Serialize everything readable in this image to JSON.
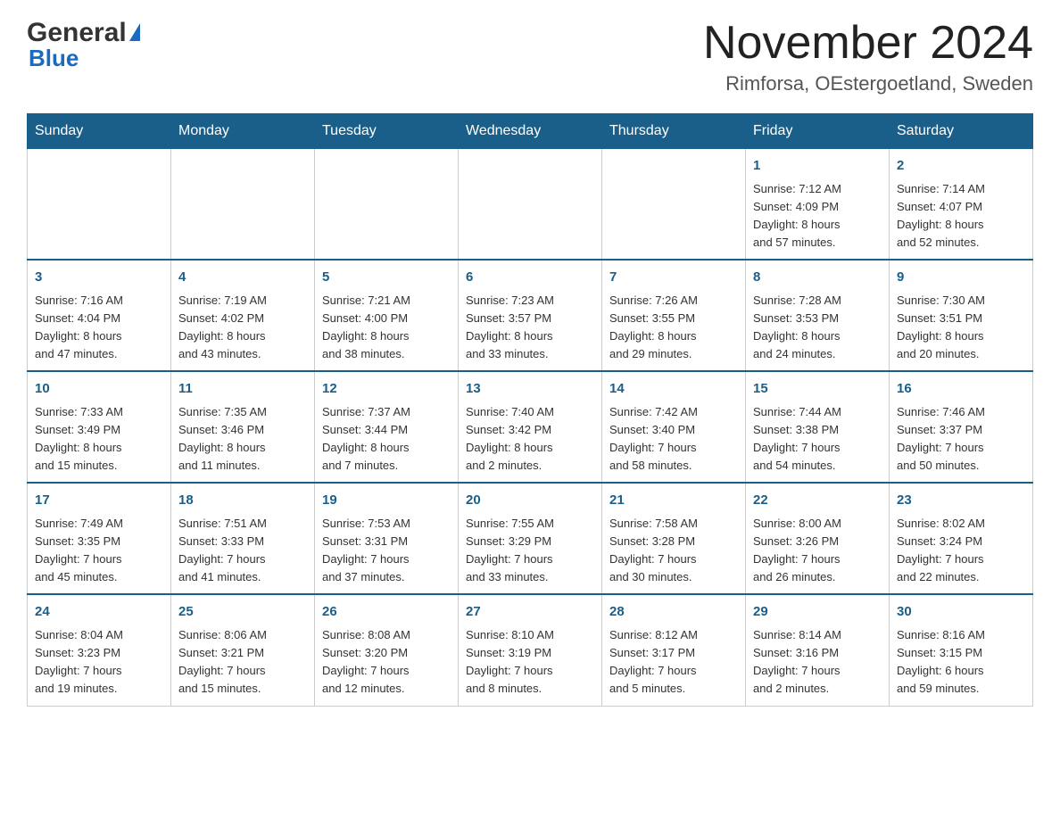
{
  "header": {
    "logo_general": "General",
    "logo_blue": "Blue",
    "month_title": "November 2024",
    "location": "Rimforsa, OEstergoetland, Sweden"
  },
  "weekdays": [
    "Sunday",
    "Monday",
    "Tuesday",
    "Wednesday",
    "Thursday",
    "Friday",
    "Saturday"
  ],
  "weeks": [
    [
      {
        "day": "",
        "info": ""
      },
      {
        "day": "",
        "info": ""
      },
      {
        "day": "",
        "info": ""
      },
      {
        "day": "",
        "info": ""
      },
      {
        "day": "",
        "info": ""
      },
      {
        "day": "1",
        "info": "Sunrise: 7:12 AM\nSunset: 4:09 PM\nDaylight: 8 hours\nand 57 minutes."
      },
      {
        "day": "2",
        "info": "Sunrise: 7:14 AM\nSunset: 4:07 PM\nDaylight: 8 hours\nand 52 minutes."
      }
    ],
    [
      {
        "day": "3",
        "info": "Sunrise: 7:16 AM\nSunset: 4:04 PM\nDaylight: 8 hours\nand 47 minutes."
      },
      {
        "day": "4",
        "info": "Sunrise: 7:19 AM\nSunset: 4:02 PM\nDaylight: 8 hours\nand 43 minutes."
      },
      {
        "day": "5",
        "info": "Sunrise: 7:21 AM\nSunset: 4:00 PM\nDaylight: 8 hours\nand 38 minutes."
      },
      {
        "day": "6",
        "info": "Sunrise: 7:23 AM\nSunset: 3:57 PM\nDaylight: 8 hours\nand 33 minutes."
      },
      {
        "day": "7",
        "info": "Sunrise: 7:26 AM\nSunset: 3:55 PM\nDaylight: 8 hours\nand 29 minutes."
      },
      {
        "day": "8",
        "info": "Sunrise: 7:28 AM\nSunset: 3:53 PM\nDaylight: 8 hours\nand 24 minutes."
      },
      {
        "day": "9",
        "info": "Sunrise: 7:30 AM\nSunset: 3:51 PM\nDaylight: 8 hours\nand 20 minutes."
      }
    ],
    [
      {
        "day": "10",
        "info": "Sunrise: 7:33 AM\nSunset: 3:49 PM\nDaylight: 8 hours\nand 15 minutes."
      },
      {
        "day": "11",
        "info": "Sunrise: 7:35 AM\nSunset: 3:46 PM\nDaylight: 8 hours\nand 11 minutes."
      },
      {
        "day": "12",
        "info": "Sunrise: 7:37 AM\nSunset: 3:44 PM\nDaylight: 8 hours\nand 7 minutes."
      },
      {
        "day": "13",
        "info": "Sunrise: 7:40 AM\nSunset: 3:42 PM\nDaylight: 8 hours\nand 2 minutes."
      },
      {
        "day": "14",
        "info": "Sunrise: 7:42 AM\nSunset: 3:40 PM\nDaylight: 7 hours\nand 58 minutes."
      },
      {
        "day": "15",
        "info": "Sunrise: 7:44 AM\nSunset: 3:38 PM\nDaylight: 7 hours\nand 54 minutes."
      },
      {
        "day": "16",
        "info": "Sunrise: 7:46 AM\nSunset: 3:37 PM\nDaylight: 7 hours\nand 50 minutes."
      }
    ],
    [
      {
        "day": "17",
        "info": "Sunrise: 7:49 AM\nSunset: 3:35 PM\nDaylight: 7 hours\nand 45 minutes."
      },
      {
        "day": "18",
        "info": "Sunrise: 7:51 AM\nSunset: 3:33 PM\nDaylight: 7 hours\nand 41 minutes."
      },
      {
        "day": "19",
        "info": "Sunrise: 7:53 AM\nSunset: 3:31 PM\nDaylight: 7 hours\nand 37 minutes."
      },
      {
        "day": "20",
        "info": "Sunrise: 7:55 AM\nSunset: 3:29 PM\nDaylight: 7 hours\nand 33 minutes."
      },
      {
        "day": "21",
        "info": "Sunrise: 7:58 AM\nSunset: 3:28 PM\nDaylight: 7 hours\nand 30 minutes."
      },
      {
        "day": "22",
        "info": "Sunrise: 8:00 AM\nSunset: 3:26 PM\nDaylight: 7 hours\nand 26 minutes."
      },
      {
        "day": "23",
        "info": "Sunrise: 8:02 AM\nSunset: 3:24 PM\nDaylight: 7 hours\nand 22 minutes."
      }
    ],
    [
      {
        "day": "24",
        "info": "Sunrise: 8:04 AM\nSunset: 3:23 PM\nDaylight: 7 hours\nand 19 minutes."
      },
      {
        "day": "25",
        "info": "Sunrise: 8:06 AM\nSunset: 3:21 PM\nDaylight: 7 hours\nand 15 minutes."
      },
      {
        "day": "26",
        "info": "Sunrise: 8:08 AM\nSunset: 3:20 PM\nDaylight: 7 hours\nand 12 minutes."
      },
      {
        "day": "27",
        "info": "Sunrise: 8:10 AM\nSunset: 3:19 PM\nDaylight: 7 hours\nand 8 minutes."
      },
      {
        "day": "28",
        "info": "Sunrise: 8:12 AM\nSunset: 3:17 PM\nDaylight: 7 hours\nand 5 minutes."
      },
      {
        "day": "29",
        "info": "Sunrise: 8:14 AM\nSunset: 3:16 PM\nDaylight: 7 hours\nand 2 minutes."
      },
      {
        "day": "30",
        "info": "Sunrise: 8:16 AM\nSunset: 3:15 PM\nDaylight: 6 hours\nand 59 minutes."
      }
    ]
  ]
}
